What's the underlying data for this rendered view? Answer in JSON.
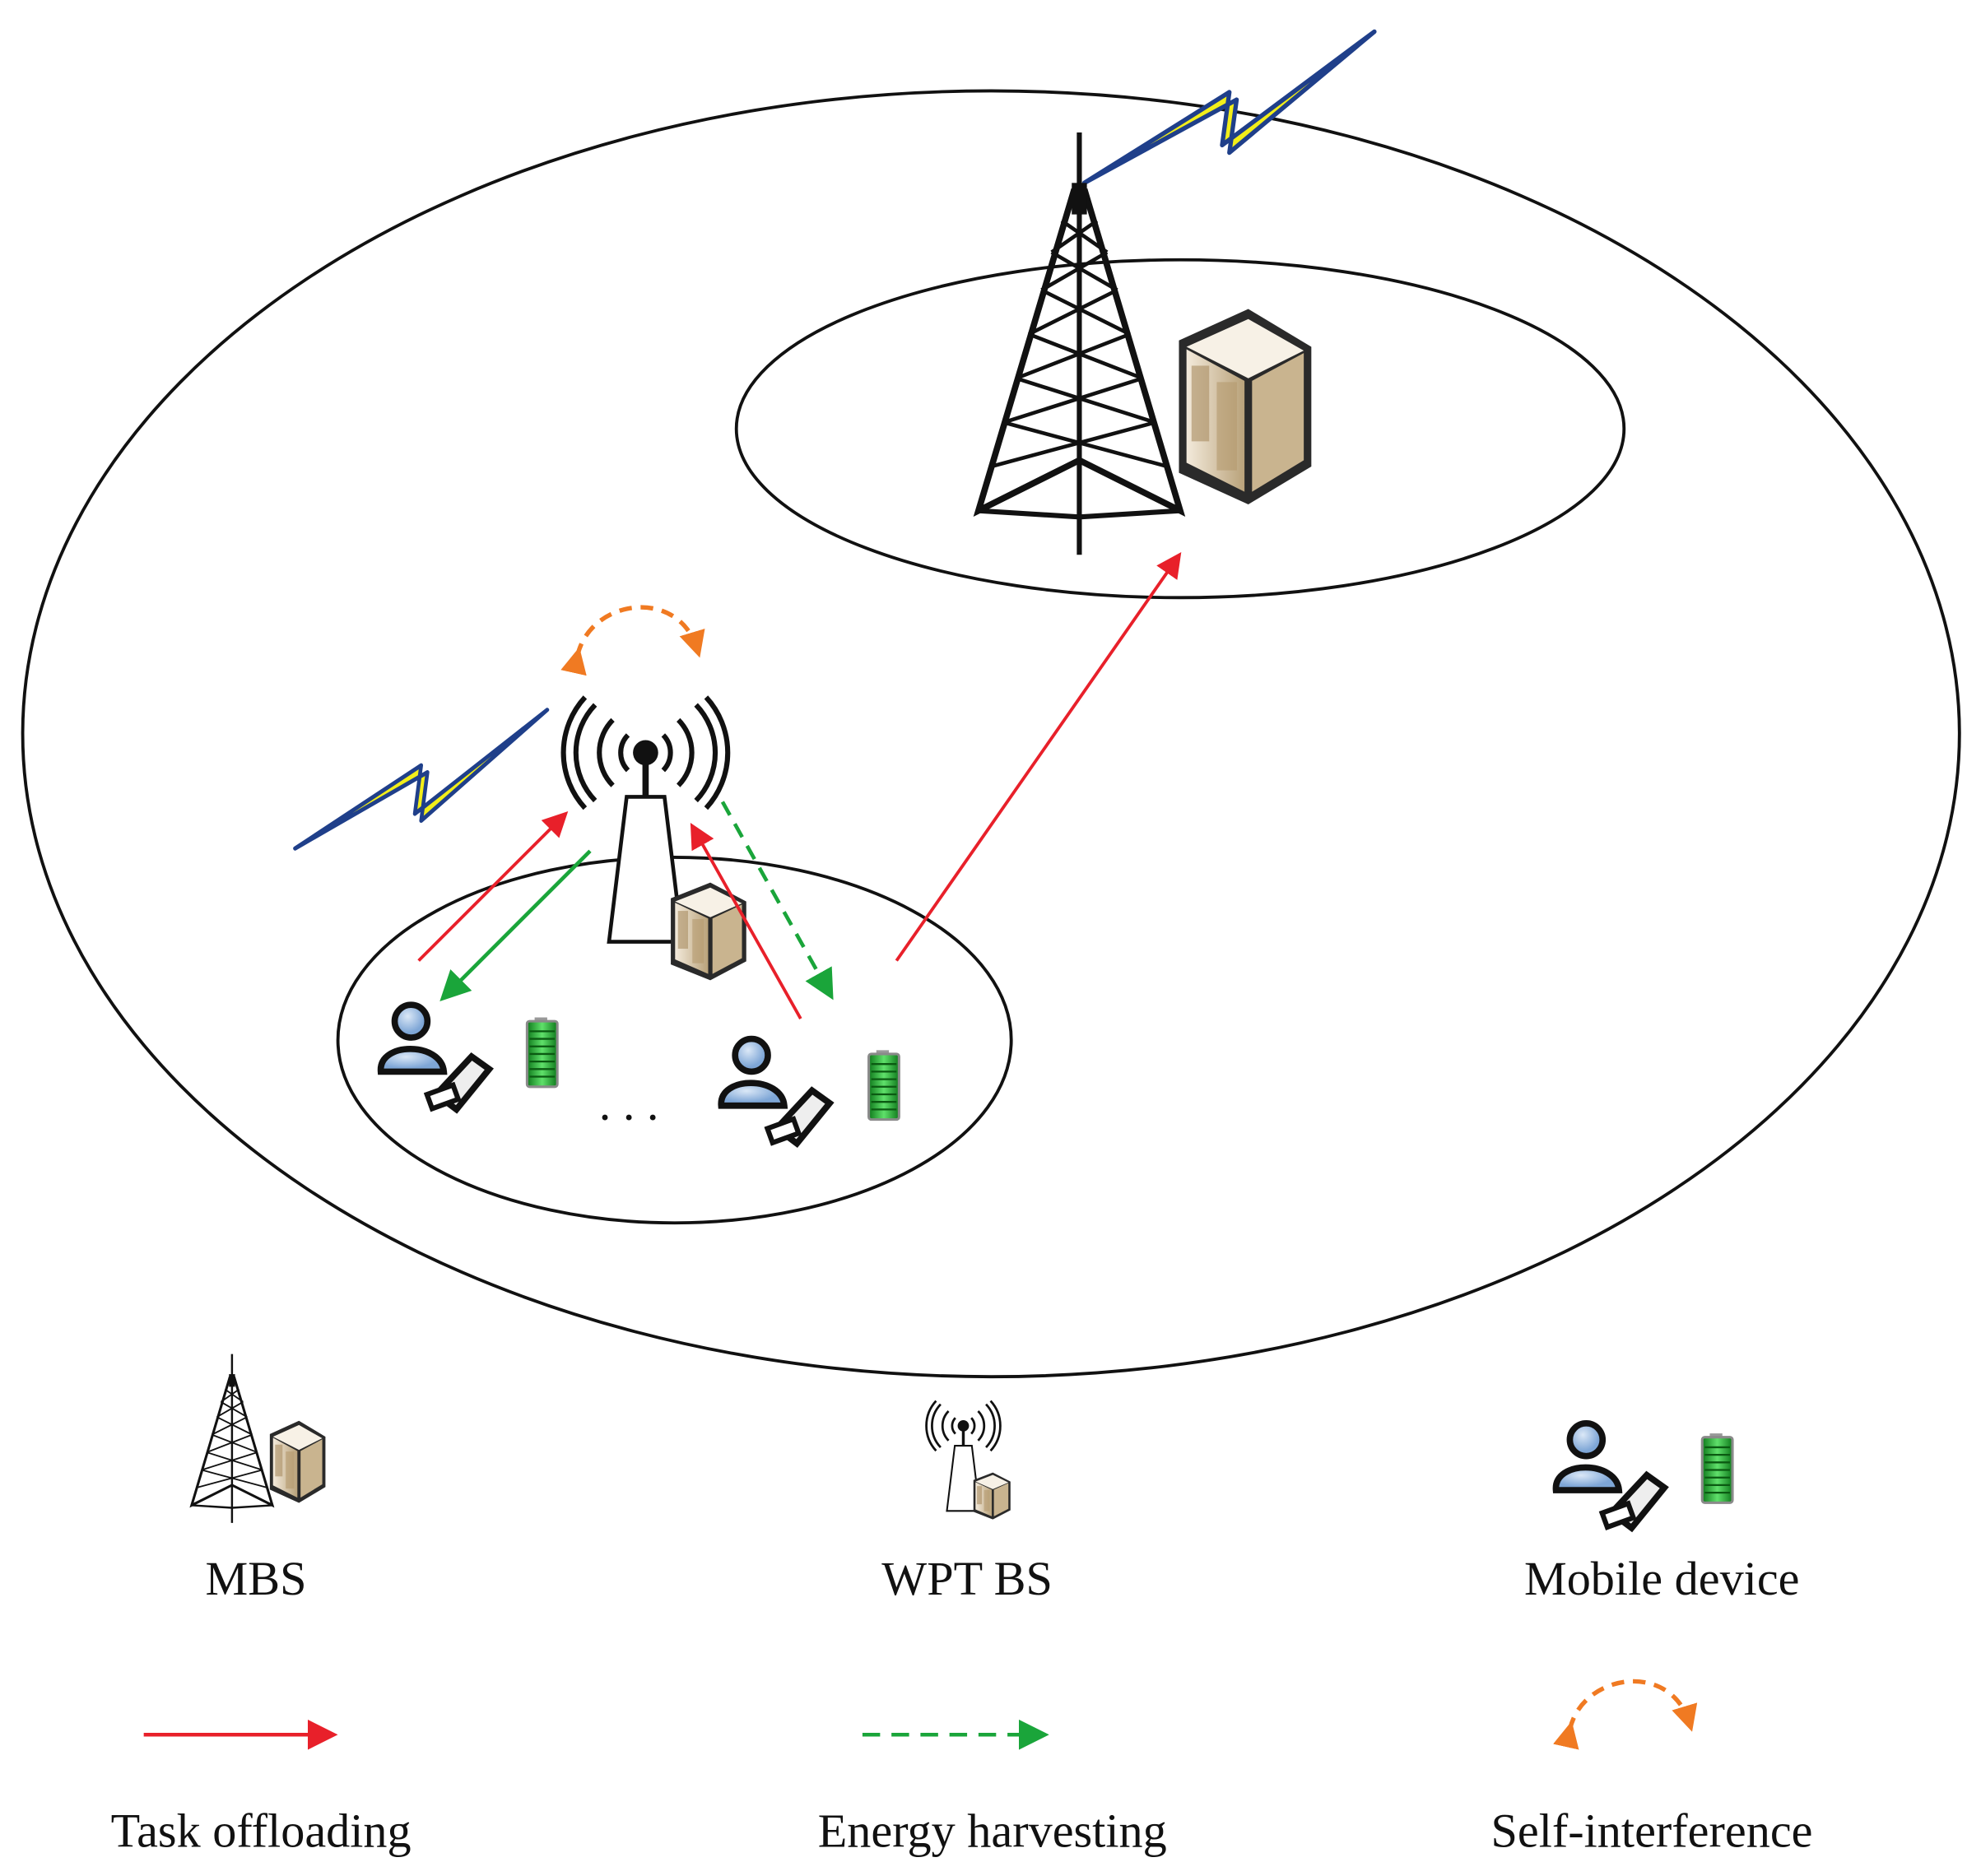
{
  "legend": {
    "mbs": "MBS",
    "wpt_bs": "WPT BS",
    "mobile_device": "Mobile device",
    "task_offloading": "Task offloading",
    "energy_harvesting": "Energy harvesting",
    "self_interference": "Self-interference"
  },
  "ellipsis": ". . .",
  "colors": {
    "task_offloading": "#e8202a",
    "energy_harvesting": "#1aa53a",
    "self_interference": "#f07a22",
    "lightning_fill": "#f2ee1a",
    "lightning_stroke": "#1f3f8a"
  }
}
